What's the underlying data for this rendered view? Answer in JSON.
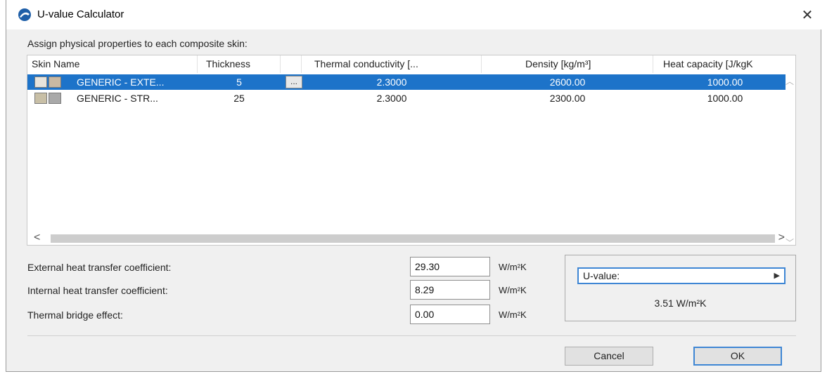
{
  "window": {
    "title": "U-value Calculator",
    "close_glyph": "✕",
    "icon": "archicad-app-icon"
  },
  "instruction": "Assign physical properties to each composite skin:",
  "table": {
    "columns": [
      "Skin Name",
      "Thickness",
      "Thermal conductivity [...",
      "Density [kg/m³]",
      "Heat capacity [J/kgK"
    ],
    "rows": [
      {
        "name": "GENERIC - EXTE...",
        "thickness": "5",
        "more": "...",
        "conductivity": "2.3000",
        "density": "2600.00",
        "heat_capacity": "1000.00",
        "selected": true,
        "swatch_colors": [
          "#e8e4dc",
          "#c9b9a3"
        ]
      },
      {
        "name": "GENERIC - STR...",
        "thickness": "25",
        "more": "",
        "conductivity": "2.3000",
        "density": "2300.00",
        "heat_capacity": "1000.00",
        "selected": false,
        "swatch_colors": [
          "#c8bfa6",
          "#a9a9a9"
        ]
      }
    ],
    "scroll_left": "<",
    "scroll_right": ">"
  },
  "fields": [
    {
      "label": "External heat transfer coefficient:",
      "value": "29.30",
      "unit": "W/m²K"
    },
    {
      "label": "Internal heat transfer coefficient:",
      "value": "8.29",
      "unit": "W/m²K"
    },
    {
      "label": "Thermal bridge effect:",
      "value": "0.00",
      "unit": "W/m²K"
    }
  ],
  "uvalue": {
    "dropdown_label": "U-value:",
    "arrow": "▶",
    "result": "3.51 W/m²K"
  },
  "buttons": {
    "cancel": "Cancel",
    "ok": "OK"
  },
  "colors": {
    "selection": "#1d73c9",
    "accent": "#3e86d4"
  }
}
